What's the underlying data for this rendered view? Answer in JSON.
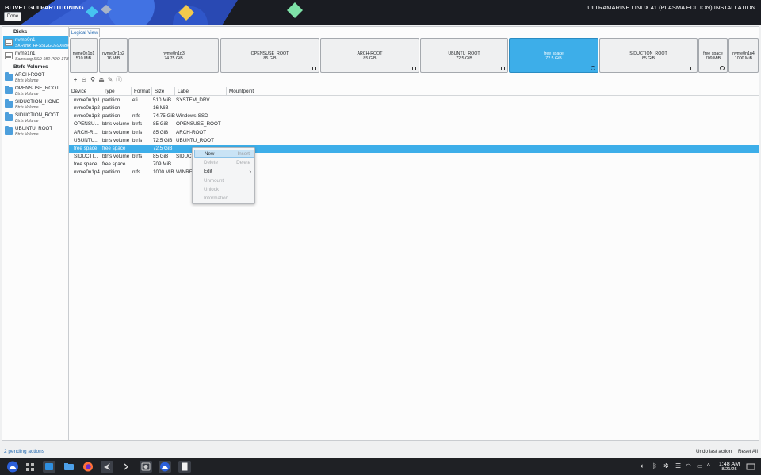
{
  "header": {
    "title": "BLIVET GUI PARTITIONING",
    "right_title": "ULTRAMARINE LINUX 41 (PLASMA EDITION) INSTALLATION",
    "done_label": "Done"
  },
  "sidebar": {
    "disks_header": "Disks",
    "disks": [
      {
        "name": "nvme0n1",
        "sub": "SKHynix_HFS512GDE9X084N"
      },
      {
        "name": "nvme1n1",
        "sub": "Samsung SSD 980 PRO 1TB"
      }
    ],
    "btrfs_header": "Btrfs Volumes",
    "volumes": [
      {
        "name": "ARCH-ROOT",
        "sub": "Btrfs Volume"
      },
      {
        "name": "OPENSUSE_ROOT",
        "sub": "Btrfs Volume"
      },
      {
        "name": "SIDUCTION_HOME",
        "sub": "Btrfs Volume"
      },
      {
        "name": "SIDUCTION_ROOT",
        "sub": "Btrfs Volume"
      },
      {
        "name": "UBUNTU_ROOT",
        "sub": "Btrfs Volume"
      }
    ]
  },
  "view_tab": "Logical View",
  "blocks": [
    {
      "name": "nvme0n1p1",
      "size": "510 MiB"
    },
    {
      "name": "nvme0n1p2",
      "size": "16 MiB"
    },
    {
      "name": "nvme0n1p3",
      "size": "74.75 GiB"
    },
    {
      "name": "OPENSUSE_ROOT",
      "size": "85 GiB"
    },
    {
      "name": "ARCH-ROOT",
      "size": "85 GiB"
    },
    {
      "name": "UBUNTU_ROOT",
      "size": "72.5 GiB"
    },
    {
      "name": "free space",
      "size": "72.5 GiB"
    },
    {
      "name": "SIDUCTION_ROOT",
      "size": "85 GiB"
    },
    {
      "name": "free space",
      "size": "709 MiB"
    },
    {
      "name": "nvme0n1p4",
      "size": "1000 MiB"
    }
  ],
  "toolbar": {
    "add": "+",
    "remove": "⊖",
    "search": "⚲",
    "unmount": "⏏",
    "edit": "✎",
    "info": "ⓘ"
  },
  "table": {
    "columns": [
      "Device",
      "Type",
      "Format",
      "Size",
      "Label",
      "Mountpoint"
    ],
    "rows": [
      [
        "nvme0n1p1",
        "partition",
        "efi",
        "510 MiB",
        "SYSTEM_DRV",
        ""
      ],
      [
        "nvme0n1p2",
        "partition",
        "",
        "16 MiB",
        "",
        ""
      ],
      [
        "nvme0n1p3",
        "partition",
        "ntfs",
        "74.75 GiB",
        "Windows-SSD",
        ""
      ],
      [
        "OPENSU...",
        "btrfs volume",
        "btrfs",
        "85 GiB",
        "OPENSUSE_ROOT",
        ""
      ],
      [
        "ARCH-R...",
        "btrfs volume",
        "btrfs",
        "85 GiB",
        "ARCH-ROOT",
        ""
      ],
      [
        "UBUNTU...",
        "btrfs volume",
        "btrfs",
        "72.5 GiB",
        "UBUNTU_ROOT",
        ""
      ],
      [
        "free space",
        "free space",
        "",
        "72.5 GiB",
        "",
        ""
      ],
      [
        "SIDUCTI...",
        "btrfs volume",
        "btrfs",
        "85 GiB",
        "SIDUCT",
        ""
      ],
      [
        "free space",
        "free space",
        "",
        "709 MiB",
        "",
        ""
      ],
      [
        "nvme0n1p4",
        "partition",
        "ntfs",
        "1000 MiB",
        "WINRE_",
        ""
      ]
    ]
  },
  "context_menu": {
    "items": [
      {
        "label": "New",
        "shortcut": "Insert"
      },
      {
        "label": "Delete",
        "shortcut": "Delete"
      },
      {
        "label": "Edit",
        "shortcut": ""
      },
      {
        "label": "Unmount",
        "shortcut": ""
      },
      {
        "label": "Unlock",
        "shortcut": ""
      },
      {
        "label": "Information",
        "shortcut": ""
      }
    ]
  },
  "footer": {
    "pending": "2 pending actions",
    "undo": "Undo last action",
    "reset": "Reset All"
  },
  "taskbar": {
    "time": "1:48 AM",
    "date": "8/21/25"
  },
  "colors": {
    "accent": "#3daee9",
    "header_bg": "#1a1c22",
    "taskbar_bg": "#1f2125"
  }
}
